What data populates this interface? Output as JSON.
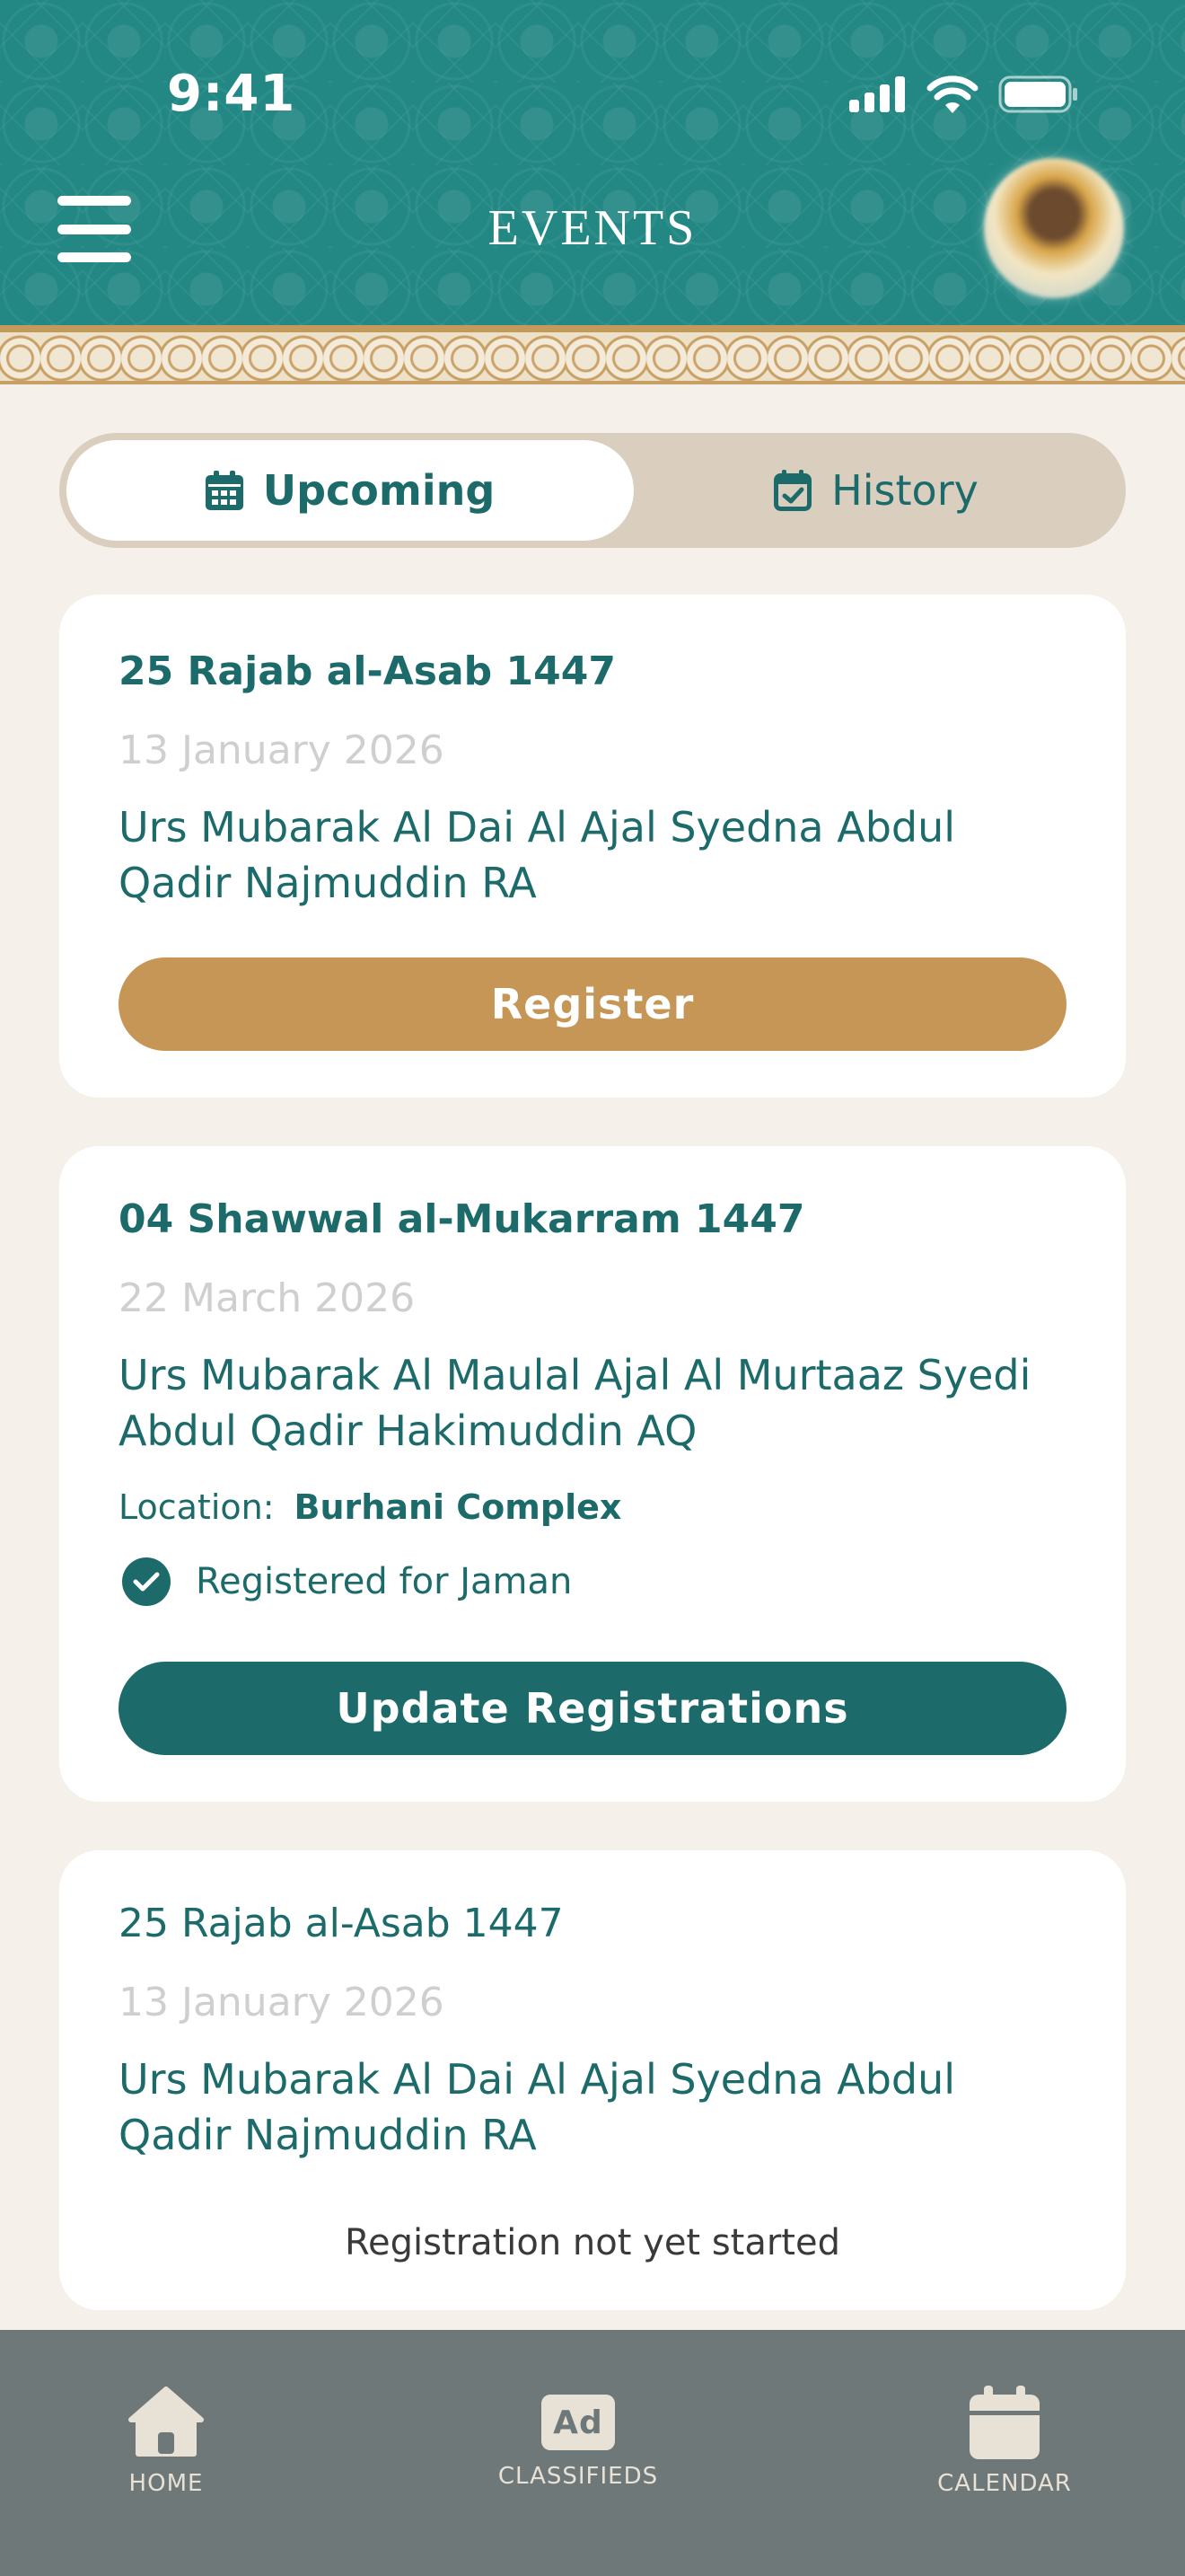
{
  "status_bar": {
    "time": "9:41"
  },
  "header": {
    "title": "EVENTS"
  },
  "tabs": [
    {
      "label": "Upcoming",
      "icon": "calendar-icon",
      "active": true
    },
    {
      "label": "History",
      "icon": "calendar-check-icon",
      "active": false
    }
  ],
  "events": [
    {
      "hijri_date": "25 Rajab al-Asab 1447",
      "date": "13 January 2026",
      "title": "Urs Mubarak Al Dai Al Ajal Syedna Abdul Qadir Najmuddin RA",
      "button_label": "Register"
    },
    {
      "hijri_date": "04 Shawwal al-Mukarram 1447",
      "date": "22 March 2026",
      "title": "Urs Mubarak Al Maulal Ajal Al Murtaaz Syedi Abdul Qadir Hakimuddin AQ",
      "location_label": "Location:",
      "location_value": "Burhani Complex",
      "registration_status": "Registered for Jaman",
      "button_label": "Update Registrations"
    },
    {
      "hijri_date": "25 Rajab al-Asab 1447",
      "date": "13 January 2026",
      "title": "Urs Mubarak Al Dai Al Ajal Syedna Abdul Qadir Najmuddin RA",
      "status_text": "Registration not yet started"
    }
  ],
  "bottom_nav": [
    {
      "label": "HOME",
      "icon": "home-icon"
    },
    {
      "label": "CLASSIFIEDS",
      "icon": "ad-icon",
      "icon_text": "Ad"
    },
    {
      "label": "CALENDAR",
      "icon": "calendar-icon"
    }
  ],
  "colors": {
    "primary": "#1c6b6a",
    "header": "#238884",
    "gold": "#c69657",
    "background": "#f5f0e9",
    "nav": "#6e7879"
  }
}
